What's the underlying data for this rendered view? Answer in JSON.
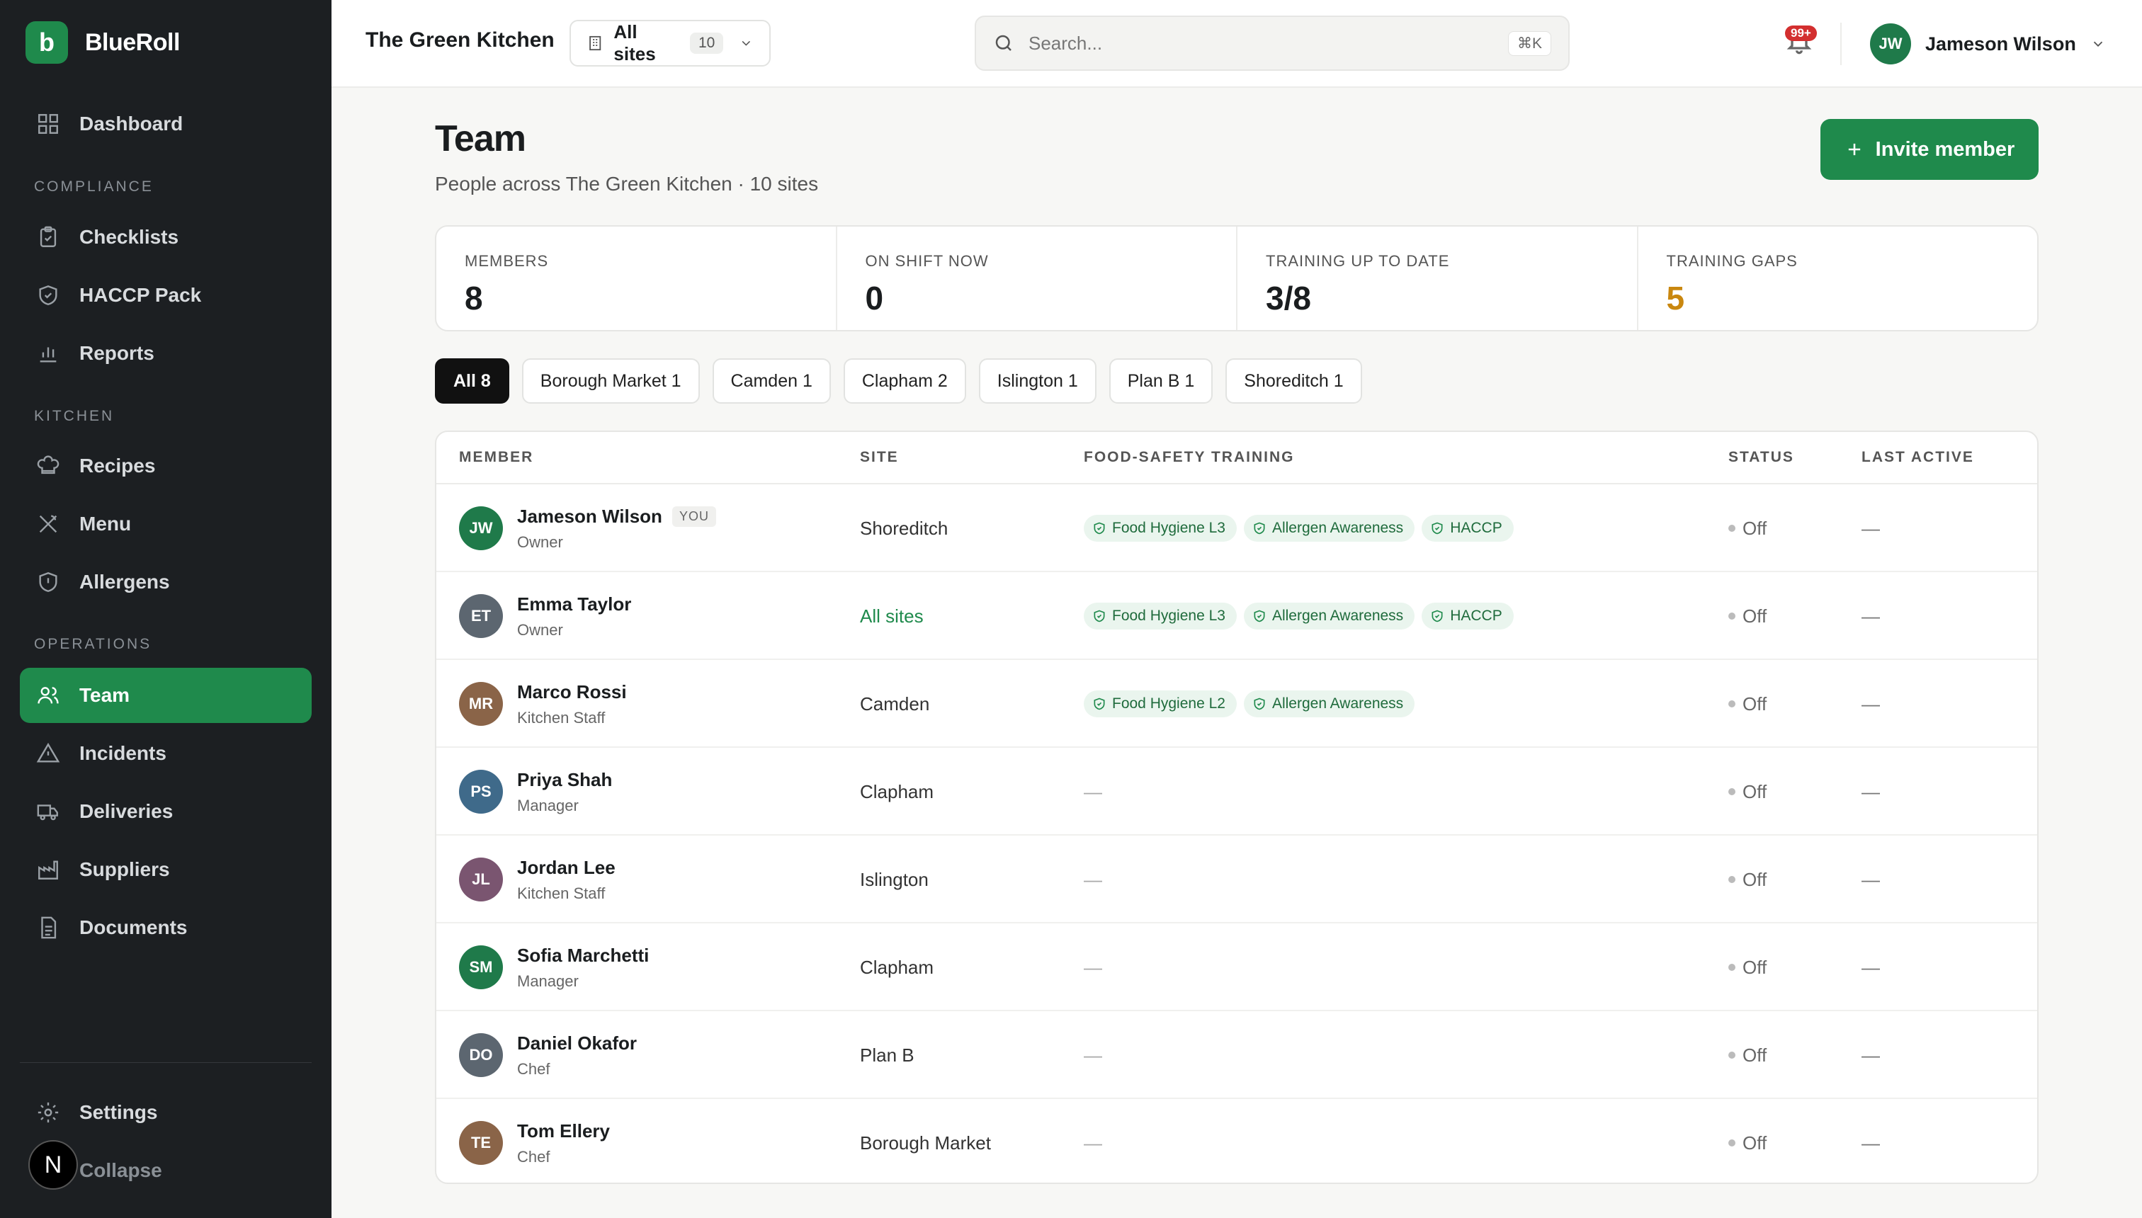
{
  "brand": {
    "logo_letter": "b",
    "name": "BlueRoll"
  },
  "sidebar": {
    "dashboard": "Dashboard",
    "sections": {
      "compliance": "COMPLIANCE",
      "kitchen": "KITCHEN",
      "operations": "OPERATIONS"
    },
    "items": {
      "checklists": "Checklists",
      "haccp": "HACCP Pack",
      "reports": "Reports",
      "recipes": "Recipes",
      "menu": "Menu",
      "allergens": "Allergens",
      "team": "Team",
      "incidents": "Incidents",
      "deliveries": "Deliveries",
      "suppliers": "Suppliers",
      "documents": "Documents"
    },
    "settings": "Settings",
    "collapse": "Collapse",
    "n_badge": "N"
  },
  "topbar": {
    "org_name": "The Green Kitchen",
    "site_select": {
      "label": "All sites",
      "count": "10"
    },
    "search": {
      "placeholder": "Search...",
      "shortcut": "⌘K"
    },
    "notifications_badge": "99+",
    "user": {
      "initials": "JW",
      "name": "Jameson Wilson"
    }
  },
  "page": {
    "title": "Team",
    "subtitle": "People across The Green Kitchen · 10 sites",
    "invite_label": "Invite member"
  },
  "stats": [
    {
      "label": "MEMBERS",
      "value": "8"
    },
    {
      "label": "ON SHIFT NOW",
      "value": "0"
    },
    {
      "label": "TRAINING UP TO DATE",
      "value": "3/8"
    },
    {
      "label": "TRAINING GAPS",
      "value": "5"
    }
  ],
  "filters": [
    "All 8",
    "Borough Market 1",
    "Camden 1",
    "Clapham 2",
    "Islington 1",
    "Plan B 1",
    "Shoreditch 1"
  ],
  "table": {
    "headers": {
      "member": "MEMBER",
      "site": "SITE",
      "training": "FOOD-SAFETY TRAINING",
      "status": "STATUS",
      "last_active": "LAST ACTIVE"
    },
    "you_tag": "YOU",
    "rows": [
      {
        "initials": "JW",
        "name": "Jameson Wilson",
        "role": "Owner",
        "site": "Shoreditch",
        "training": [
          "Food Hygiene L3",
          "Allergen Awareness",
          "HACCP"
        ],
        "status": "Off",
        "last_active": "—",
        "training_empty": ""
      },
      {
        "initials": "ET",
        "name": "Emma Taylor",
        "role": "Owner",
        "site": "All sites",
        "training": [
          "Food Hygiene L3",
          "Allergen Awareness",
          "HACCP"
        ],
        "status": "Off",
        "last_active": "—",
        "training_empty": ""
      },
      {
        "initials": "MR",
        "name": "Marco Rossi",
        "role": "Kitchen Staff",
        "site": "Camden",
        "training": [
          "Food Hygiene L2",
          "Allergen Awareness"
        ],
        "status": "Off",
        "last_active": "—",
        "training_empty": ""
      },
      {
        "initials": "PS",
        "name": "Priya Shah",
        "role": "Manager",
        "site": "Clapham",
        "training": [],
        "status": "Off",
        "last_active": "—",
        "training_empty": "—"
      },
      {
        "initials": "JL",
        "name": "Jordan Lee",
        "role": "Kitchen Staff",
        "site": "Islington",
        "training": [],
        "status": "Off",
        "last_active": "—",
        "training_empty": "—"
      },
      {
        "initials": "SM",
        "name": "Sofia Marchetti",
        "role": "Manager",
        "site": "Clapham",
        "training": [],
        "status": "Off",
        "last_active": "—",
        "training_empty": "—"
      },
      {
        "initials": "DO",
        "name": "Daniel Okafor",
        "role": "Chef",
        "site": "Plan B",
        "training": [],
        "status": "Off",
        "last_active": "—",
        "training_empty": "—"
      },
      {
        "initials": "TE",
        "name": "Tom Ellery",
        "role": "Chef",
        "site": "Borough Market",
        "training": [],
        "status": "Off",
        "last_active": "—",
        "training_empty": "—"
      }
    ]
  },
  "colors": {
    "accent": "#1f8a4c",
    "sidebar_bg": "#1c1f22",
    "warning": "#c9870f",
    "avatars": {
      "JW": "#1f7a4a",
      "ET": "#5c6670",
      "MR": "#8a6448",
      "PS": "#3f6a8a",
      "JL": "#7a5570",
      "SM": "#1f7a4a",
      "DO": "#5c6670",
      "TE": "#8a6448"
    }
  }
}
